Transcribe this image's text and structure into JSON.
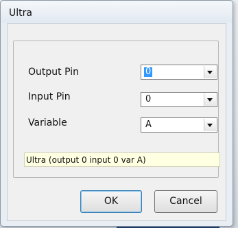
{
  "dialog": {
    "title": "Ultra"
  },
  "form": {
    "output_pin": {
      "label": "Output Pin",
      "value": "0"
    },
    "input_pin": {
      "label": "Input Pin",
      "value": "0"
    },
    "variable": {
      "label": "Variable",
      "value": "A"
    }
  },
  "status_text": "Ultra (output 0 input 0 var A)",
  "buttons": {
    "ok": "OK",
    "cancel": "Cancel"
  },
  "colors": {
    "selection": "#3399ff",
    "status_bg": "#ffffe1",
    "default_button_border": "#3c7fb1"
  }
}
